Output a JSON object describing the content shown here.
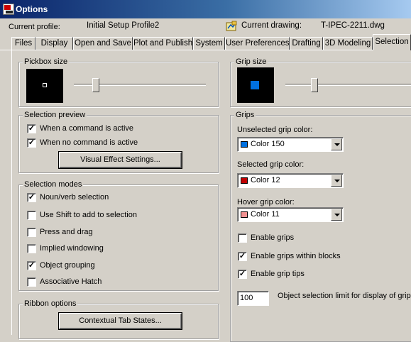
{
  "window": {
    "title": "Options"
  },
  "profile": {
    "label": "Current profile:",
    "value": "Initial Setup Profile2"
  },
  "drawing": {
    "label": "Current drawing:",
    "value": "T-IPEC-2211.dwg"
  },
  "tabs": [
    {
      "label": "Files"
    },
    {
      "label": "Display"
    },
    {
      "label": "Open and Save"
    },
    {
      "label": "Plot and Publish"
    },
    {
      "label": "System"
    },
    {
      "label": "User Preferences"
    },
    {
      "label": "Drafting"
    },
    {
      "label": "3D Modeling"
    },
    {
      "label": "Selection",
      "active": true
    }
  ],
  "pickbox": {
    "title": "Pickbox size"
  },
  "selection_preview": {
    "title": "Selection preview",
    "options": [
      {
        "label": "When a command is active",
        "checked": true
      },
      {
        "label": "When no command is active",
        "checked": true
      }
    ],
    "button": "Visual Effect Settings..."
  },
  "selection_modes": {
    "title": "Selection modes",
    "options": [
      {
        "label": "Noun/verb selection",
        "checked": true
      },
      {
        "label": "Use Shift to add to selection",
        "checked": false
      },
      {
        "label": "Press and drag",
        "checked": false
      },
      {
        "label": "Implied windowing",
        "checked": false
      },
      {
        "label": "Object grouping",
        "checked": true
      },
      {
        "label": "Associative Hatch",
        "checked": false
      }
    ]
  },
  "ribbon": {
    "title": "Ribbon options",
    "button": "Contextual Tab States..."
  },
  "grip_size": {
    "title": "Grip size"
  },
  "grips": {
    "title": "Grips",
    "unselected": {
      "label": "Unselected grip color:",
      "value": "Color 150",
      "color": "#0070e0"
    },
    "selected": {
      "label": "Selected grip color:",
      "value": "Color 12",
      "color": "#c00000"
    },
    "hover": {
      "label": "Hover grip color:",
      "value": "Color 11",
      "color": "#f09090"
    },
    "options": [
      {
        "label": "Enable grips",
        "checked": false
      },
      {
        "label": "Enable grips within blocks",
        "checked": true
      },
      {
        "label": "Enable grip tips",
        "checked": true
      }
    ],
    "limit_value": "100",
    "limit_label": "Object selection limit for display of grips"
  }
}
